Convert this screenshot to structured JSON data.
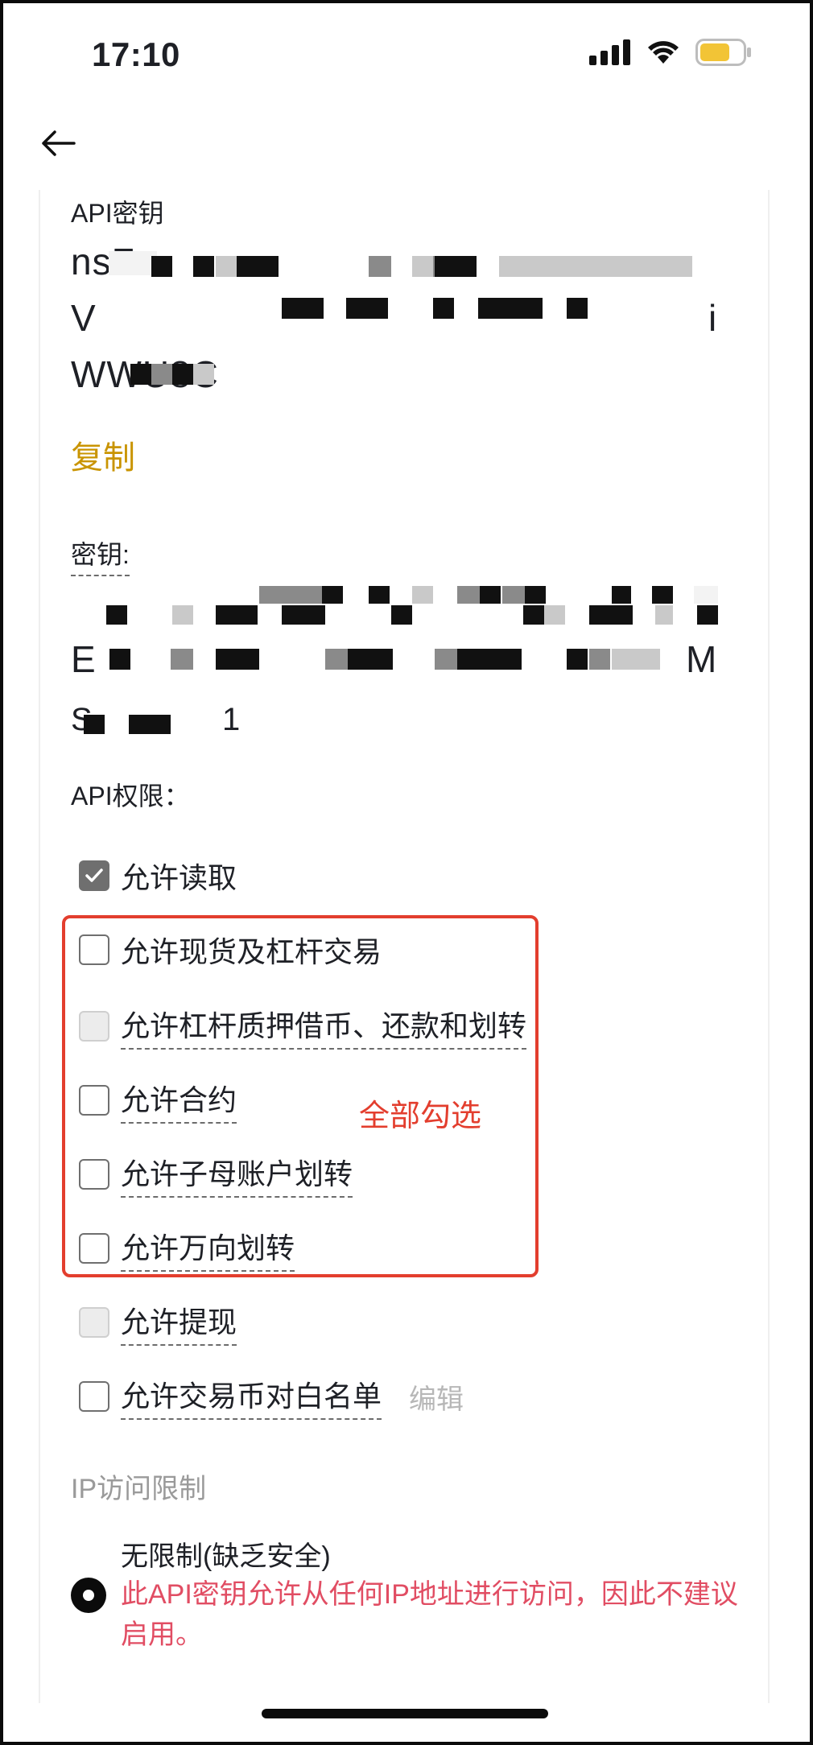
{
  "status_bar": {
    "time": "17:10"
  },
  "api_key": {
    "label": "API密钥",
    "line1": "nsF",
    "line2": "V",
    "line2_end": "i",
    "line3": "WWU8C",
    "copy_label": "复制"
  },
  "secret": {
    "label": "密钥:",
    "line2_start": "E",
    "line2_end": "M",
    "line3_start": "S",
    "line3_end": "1"
  },
  "permissions": {
    "title": "API权限：",
    "items": [
      {
        "label": "允许读取",
        "state": "checked"
      },
      {
        "label": "允许现货及杠杆交易",
        "state": "unchecked"
      },
      {
        "label": "允许杠杆质押借币、还款和划转",
        "state": "disabled"
      },
      {
        "label": "允许合约",
        "state": "unchecked"
      },
      {
        "label": "允许子母账户划转",
        "state": "unchecked"
      },
      {
        "label": "允许万向划转",
        "state": "unchecked"
      },
      {
        "label": "允许提现",
        "state": "disabled"
      },
      {
        "label": "允许交易币对白名单",
        "state": "unchecked"
      }
    ],
    "edit_label": "编辑",
    "annotation": "全部勾选"
  },
  "ip_restriction": {
    "title": "IP访问限制",
    "option_label": "无限制(缺乏安全)",
    "warning": "此API密钥允许从任何IP地址进行访问，因此不建议启用。"
  },
  "colors": {
    "accent": "#c99400",
    "annotation": "#e33e2e",
    "warning": "#e14d63"
  }
}
